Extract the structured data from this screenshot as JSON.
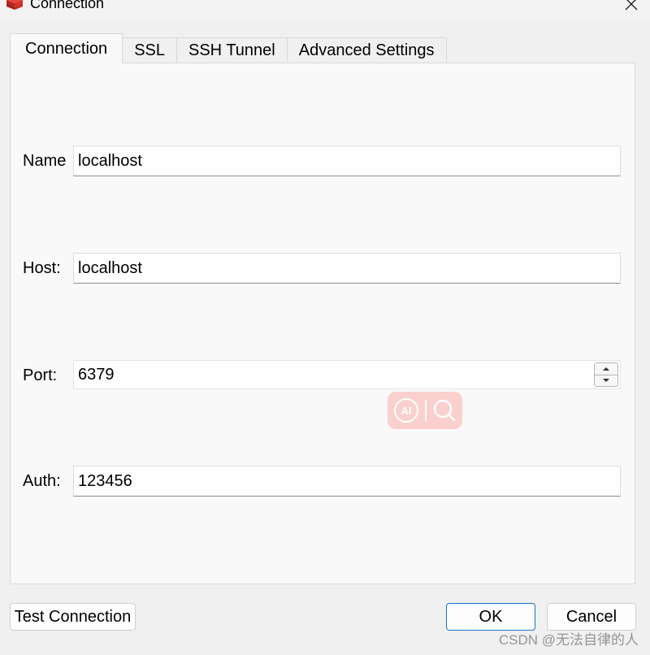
{
  "window": {
    "title": "Connection"
  },
  "tabs": [
    {
      "label": "Connection",
      "active": true
    },
    {
      "label": "SSL",
      "active": false
    },
    {
      "label": "SSH Tunnel",
      "active": false
    },
    {
      "label": "Advanced Settings",
      "active": false
    }
  ],
  "form": {
    "name": {
      "label": "Name",
      "value": "localhost"
    },
    "host": {
      "label": "Host:",
      "value": "localhost"
    },
    "port": {
      "label": "Port:",
      "value": "6379"
    },
    "auth": {
      "label": "Auth:",
      "value": "123456"
    }
  },
  "buttons": {
    "test_connection": "Test Connection",
    "ok": "OK",
    "cancel": "Cancel"
  },
  "overlay": {
    "ai_label": "AI"
  },
  "watermark": "CSDN @无法自律的人",
  "icons": {
    "app": "redis-icon",
    "close": "close-icon",
    "spin_up": "chevron-up-icon",
    "spin_down": "chevron-down-icon",
    "search": "search-icon"
  },
  "colors": {
    "ok_border": "#1a73c7",
    "app_icon": "#d82c20",
    "overlay": "#f8b4af"
  }
}
